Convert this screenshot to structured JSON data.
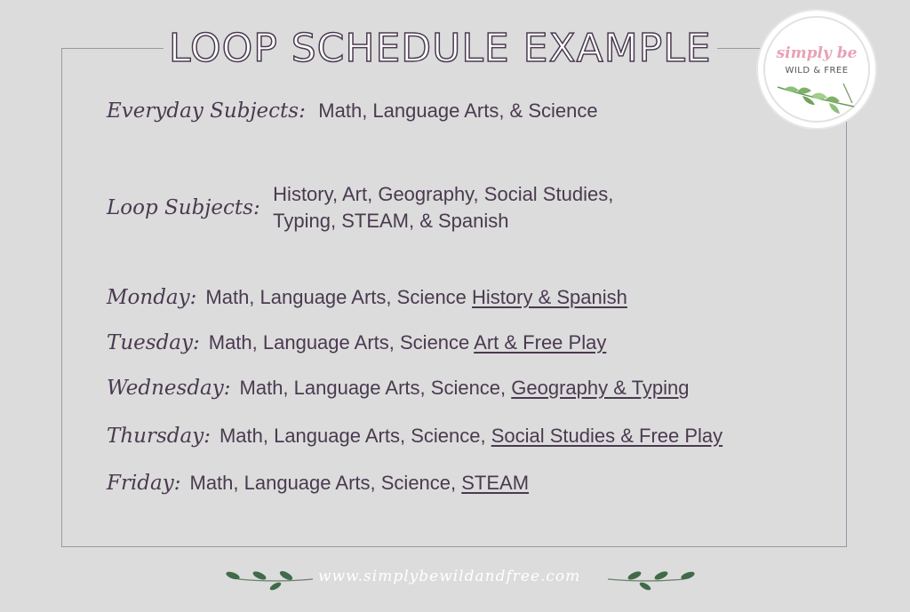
{
  "title": "LOOP SCHEDULE EXAMPLE",
  "logo": {
    "script_text": "simply be",
    "sub_text": "WILD & FREE",
    "icon": "leaf-branch-icon",
    "script_color": "#e8a1b5",
    "leaf_color": "#7fb069"
  },
  "everyday": {
    "label": "Everyday Subjects:",
    "value": "Math, Language Arts, & Science"
  },
  "loop": {
    "label": "Loop Subjects:",
    "line1": "History, Art, Geography, Social Studies,",
    "line2": "Typing, STEAM, & Spanish"
  },
  "days": [
    {
      "label": "Monday:",
      "core": "Math, Language Arts, Science ",
      "loop": "History & Spanish"
    },
    {
      "label": "Tuesday:",
      "core": "Math, Language Arts, Science ",
      "loop": "Art & Free Play"
    },
    {
      "label": "Wednesday:",
      "core": "Math, Language Arts, Science, ",
      "loop": "Geography & Typing"
    },
    {
      "label": "Thursday:",
      "core": "Math, Language Arts, Science, ",
      "loop": "Social Studies & Free Play"
    },
    {
      "label": "Friday:",
      "core": "Math, Language Arts, Science, ",
      "loop": "STEAM"
    }
  ],
  "footer": {
    "url": "www.simplybewildandfree.com",
    "icon": "leaf-vine-icon"
  },
  "colors": {
    "background": "#dcdcdc",
    "text": "#4a3a50",
    "frame": "#9a98a4",
    "leaf": "#3f6b4a"
  }
}
